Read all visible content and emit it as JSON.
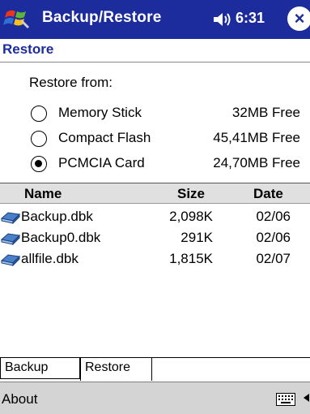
{
  "titlebar": {
    "title": "Backup/Restore",
    "time": "6:31",
    "close_label": "×",
    "start_icon": "windows-flag-icon",
    "volume_icon": "speaker-icon"
  },
  "page": {
    "title": "Restore"
  },
  "restore_from": {
    "label": "Restore from:",
    "options": [
      {
        "label": "Memory Stick",
        "free": "32MB Free",
        "selected": false
      },
      {
        "label": "Compact Flash",
        "free": "45,41MB Free",
        "selected": false
      },
      {
        "label": "PCMCIA Card",
        "free": "24,70MB Free",
        "selected": true
      }
    ]
  },
  "file_list": {
    "columns": {
      "name": "Name",
      "size": "Size",
      "date": "Date"
    },
    "rows": [
      {
        "name": "Backup.dbk",
        "size": "2,098K",
        "date": "02/06"
      },
      {
        "name": "Backup0.dbk",
        "size": "291K",
        "date": "02/06"
      },
      {
        "name": "allfile.dbk",
        "size": "1,815K",
        "date": "02/07"
      }
    ]
  },
  "tabs": {
    "items": [
      {
        "label": "Backup",
        "active": false
      },
      {
        "label": "Restore",
        "active": true
      }
    ]
  },
  "menubar": {
    "about": "About",
    "keyboard_icon": "keyboard-icon"
  },
  "colors": {
    "titlebar": "#1d2c9c",
    "accent_text": "#1d2c9c",
    "menubar": "#d4d4d4",
    "grid_header": "#e0e0e0"
  }
}
